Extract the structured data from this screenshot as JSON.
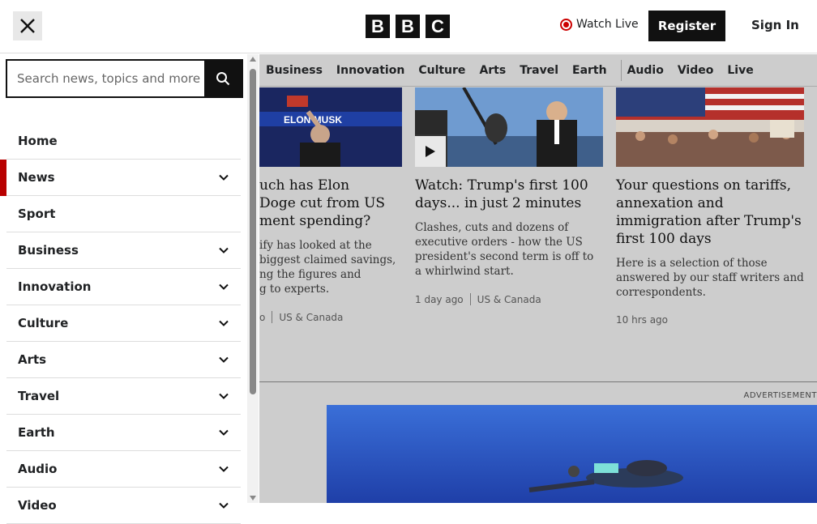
{
  "header": {
    "logo_letters": [
      "B",
      "B",
      "C"
    ],
    "watch_live": "Watch Live",
    "register": "Register",
    "sign_in": "Sign In"
  },
  "search": {
    "placeholder": "Search news, topics and more"
  },
  "menu": {
    "items": [
      {
        "label": "Home",
        "expandable": false,
        "active": false
      },
      {
        "label": "News",
        "expandable": true,
        "active": true
      },
      {
        "label": "Sport",
        "expandable": false,
        "active": false
      },
      {
        "label": "Business",
        "expandable": true,
        "active": false
      },
      {
        "label": "Innovation",
        "expandable": true,
        "active": false
      },
      {
        "label": "Culture",
        "expandable": true,
        "active": false
      },
      {
        "label": "Arts",
        "expandable": true,
        "active": false
      },
      {
        "label": "Travel",
        "expandable": true,
        "active": false
      },
      {
        "label": "Earth",
        "expandable": true,
        "active": false
      },
      {
        "label": "Audio",
        "expandable": true,
        "active": false
      },
      {
        "label": "Video",
        "expandable": true,
        "active": false
      }
    ]
  },
  "nav": [
    "Business",
    "Innovation",
    "Culture",
    "Arts",
    "Travel",
    "Earth",
    "Audio",
    "Video",
    "Live"
  ],
  "cards": [
    {
      "title": "uch has Elon\n Doge cut from US\nment spending?",
      "summary": "ify has looked at the\n biggest claimed savings,\nng the figures and\ng to experts.",
      "time": "o",
      "section": "US & Canada",
      "image_text": "ELON MUSK"
    },
    {
      "title": "Watch: Trump's first 100 days... in just 2 minutes",
      "summary": "Clashes, cuts and dozens of executive orders - how the US president's second term is off to a whirlwind start.",
      "time": "1 day ago",
      "section": "US & Canada"
    },
    {
      "title": "Your questions on tariffs, annexation and immigration after Trump's first 100 days",
      "summary": "Here is a selection of those answered by our staff writers and correspondents.",
      "time": "10 hrs ago"
    }
  ],
  "advertisement": "ADVERTISEMENT",
  "colors": {
    "accent": "#b80000",
    "brand": "#111111",
    "overlay": "#cdcdcd"
  }
}
